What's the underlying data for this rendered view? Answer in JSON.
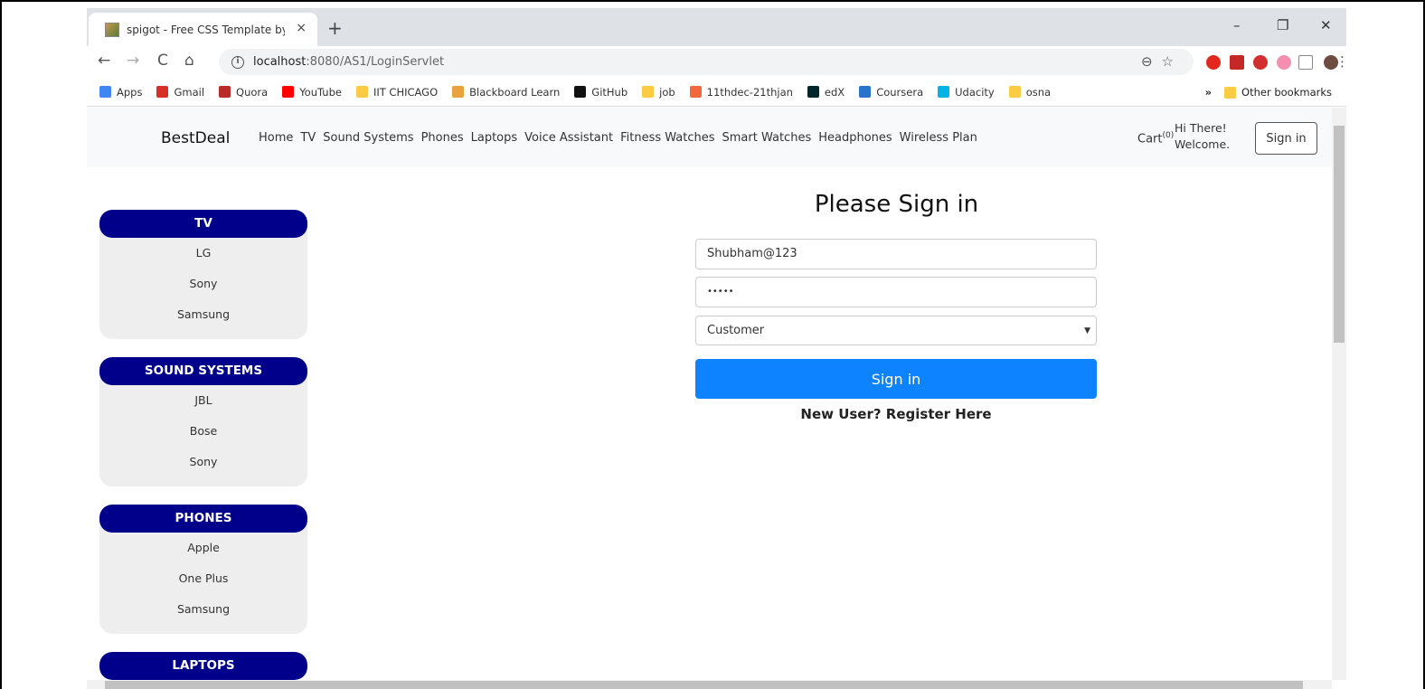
{
  "browser": {
    "tab_title": "spigot - Free CSS Template by Zy",
    "tab_close": "×",
    "new_tab": "+",
    "minimize": "–",
    "restore": "❐",
    "close": "✕",
    "back": "←",
    "forward": "→",
    "reload": "C",
    "home": "⌂",
    "url_host": "localhost",
    "url_path": ":8080/AS1/LoginServlet",
    "info": "i",
    "omni_icons": "⊖☆",
    "menu": "⋮",
    "bookmarks": [
      {
        "label": "Apps",
        "color": "#4285f4"
      },
      {
        "label": "Gmail",
        "color": "#d93025"
      },
      {
        "label": "Quora",
        "color": "#b92b27"
      },
      {
        "label": "YouTube",
        "color": "#ff0000"
      },
      {
        "label": "IIT CHICAGO",
        "color": "#fbcb43"
      },
      {
        "label": "Blackboard Learn",
        "color": "#e8a33c"
      },
      {
        "label": "GitHub",
        "color": "#111111"
      },
      {
        "label": "job",
        "color": "#fbcb43"
      },
      {
        "label": "11thdec-21thjan",
        "color": "#f2683c"
      },
      {
        "label": "edX",
        "color": "#02262b"
      },
      {
        "label": "Coursera",
        "color": "#2a73cc"
      },
      {
        "label": "Udacity",
        "color": "#02b3e4"
      },
      {
        "label": "osna",
        "color": "#fbcb43"
      }
    ],
    "more_bookmarks": "»",
    "other_bookmarks": "Other bookmarks"
  },
  "site": {
    "brand": "BestDeal",
    "nav": [
      "Home",
      "TV",
      "Sound Systems",
      "Phones",
      "Laptops",
      "Voice Assistant",
      "Fitness Watches",
      "Smart Watches",
      "Headphones",
      "Wireless Plan"
    ],
    "cart_label": "Cart",
    "cart_count": "(0)",
    "greeting_line1": "Hi There!",
    "greeting_line2": "Welcome.",
    "signin_button": "Sign in"
  },
  "sidebar": [
    {
      "title": "TV",
      "items": [
        "LG",
        "Sony",
        "Samsung"
      ]
    },
    {
      "title": "SOUND SYSTEMS",
      "items": [
        "JBL",
        "Bose",
        "Sony"
      ]
    },
    {
      "title": "PHONES",
      "items": [
        "Apple",
        "One Plus",
        "Samsung"
      ]
    },
    {
      "title": "LAPTOPS",
      "items": []
    }
  ],
  "login": {
    "title": "Please Sign in",
    "username_value": "Shubham@123",
    "password_value": "•••••",
    "role_value": "Customer",
    "submit_label": "Sign in",
    "register_link": "New User? Register Here"
  }
}
